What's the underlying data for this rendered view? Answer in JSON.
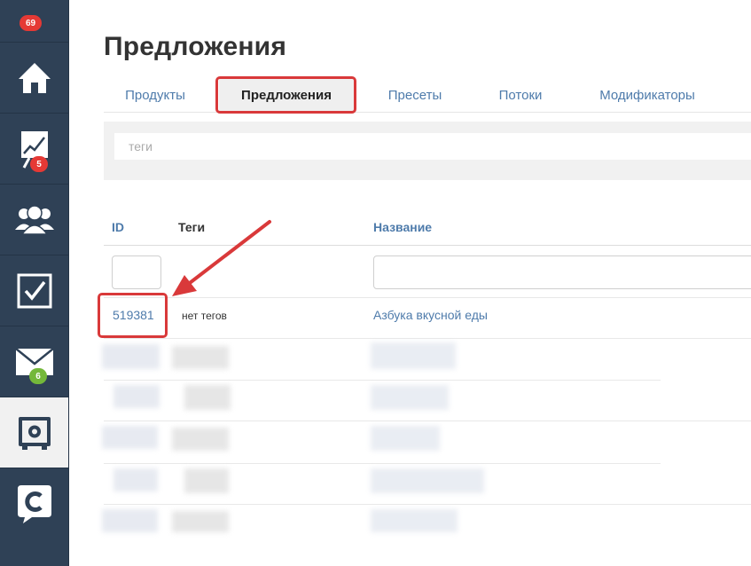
{
  "sidebar": {
    "items": [
      {
        "name": "home-icon",
        "badge": null
      },
      {
        "name": "chart-icon",
        "badge": "5"
      },
      {
        "name": "users-icon",
        "badge": null
      },
      {
        "name": "tasks-icon",
        "badge": null
      },
      {
        "name": "mail-icon",
        "badge": "6"
      },
      {
        "name": "safe-icon",
        "badge": null
      },
      {
        "name": "brand-icon",
        "badge": null
      }
    ],
    "top_badge": "69",
    "colors": {
      "background": "#2f4156",
      "active": "#f1f1f1",
      "badge_red": "#e53935",
      "badge_green": "#74b83a"
    }
  },
  "page": {
    "title": "Предложения"
  },
  "tabs": [
    {
      "label": "Продукты"
    },
    {
      "label": "Предложения"
    },
    {
      "label": "Пресеты"
    },
    {
      "label": "Потоки"
    },
    {
      "label": "Модификаторы"
    }
  ],
  "filter": {
    "tags_placeholder": "теги"
  },
  "table": {
    "columns": {
      "id": "ID",
      "tags": "Теги",
      "name": "Название"
    },
    "rows": [
      {
        "id": "519381",
        "tags": "нет тегов",
        "name": "Азбука вкусной еды"
      }
    ]
  },
  "accent": {
    "highlight": "#d9393a",
    "link": "#4e7bab"
  }
}
